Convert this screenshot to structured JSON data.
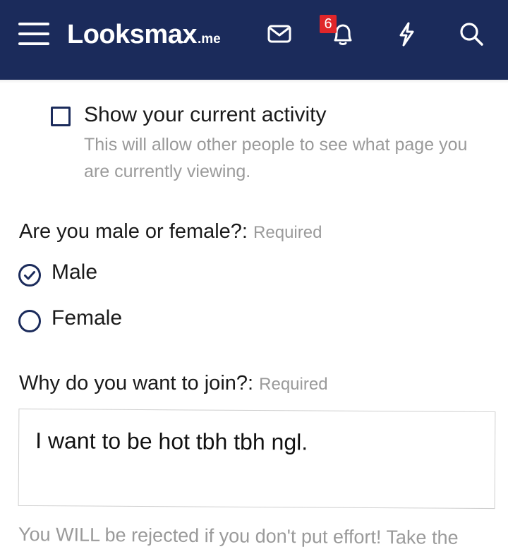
{
  "header": {
    "logo_main": "Looksmax",
    "logo_ext": ".me",
    "notification_count": "6",
    "colors": {
      "bar": "#1b2b5b",
      "badge": "#e0262a"
    },
    "icons": [
      "menu-icon",
      "mail-icon",
      "bell-icon",
      "lightning-icon",
      "search-icon"
    ]
  },
  "activity": {
    "label": "Show your current activity",
    "hint": "This will allow other people to see what page you are currently viewing.",
    "checked": false
  },
  "gender": {
    "question": "Are you male or female?:",
    "required": "Required",
    "options": [
      {
        "label": "Male",
        "selected": true
      },
      {
        "label": "Female",
        "selected": false
      }
    ]
  },
  "join": {
    "question": "Why do you want to join?:",
    "required": "Required",
    "answer": "I want to be hot tbh tbh ngl."
  },
  "footer": {
    "hint": "You WILL be rejected if you don't put effort! Take the"
  }
}
